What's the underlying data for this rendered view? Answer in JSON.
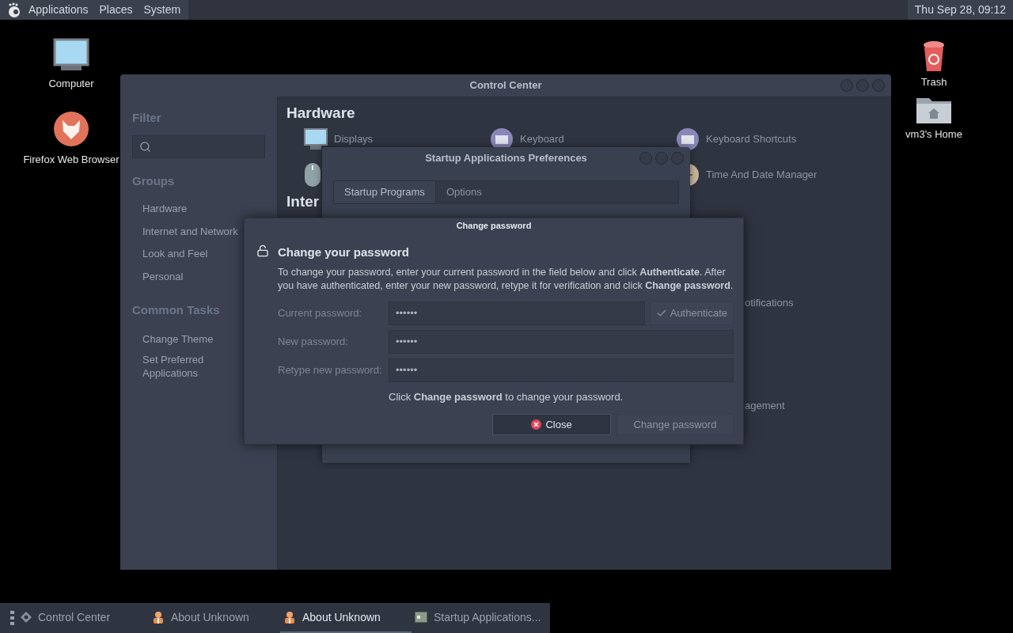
{
  "top_panel": {
    "menus": [
      {
        "label": "Applications"
      },
      {
        "label": "Places"
      },
      {
        "label": "System"
      }
    ],
    "clock": "Thu Sep 28, 09:12"
  },
  "desktop_icons": {
    "left": [
      {
        "label": "Computer",
        "kind": "computer"
      },
      {
        "label": "Firefox Web Browser",
        "kind": "browser"
      }
    ],
    "right": [
      {
        "label": "Trash",
        "kind": "trash"
      },
      {
        "label": "vm3's Home",
        "kind": "home"
      }
    ]
  },
  "control_center": {
    "title": "Control Center",
    "filter_heading": "Filter",
    "groups_heading": "Groups",
    "groups": [
      "Hardware",
      "Internet and Network",
      "Look and Feel",
      "Personal"
    ],
    "common_tasks_heading": "Common Tasks",
    "tasks": [
      "Change Theme",
      "Set Preferred Applications"
    ],
    "sections": [
      {
        "heading": "Hardware",
        "items": [
          {
            "label": "Displays",
            "kind": "display"
          },
          {
            "label": "Keyboard",
            "kind": "keyboard"
          },
          {
            "label": "Keyboard Shortcuts",
            "kind": "shortcuts"
          },
          {
            "kind": "mouse"
          },
          {
            "kind": "covered"
          },
          {
            "label": "Time And Date Manager",
            "kind": "clock"
          }
        ]
      },
      {
        "heading": "Inter"
      }
    ],
    "fragments": [
      "otifications",
      "agement"
    ]
  },
  "startup_window": {
    "title": "Startup Applications Preferences",
    "tabs": [
      {
        "label": "Startup Programs",
        "selected": true
      },
      {
        "label": "Options",
        "selected": false
      }
    ]
  },
  "password_dialog": {
    "title": "Change password",
    "heading": "Change your password",
    "message": "To change your password, enter your current password in the field below and click **Authenticate**. After you have authenticated, enter your new password, retype it for verification and click **Change password**.",
    "fields": [
      {
        "label": "Current password:",
        "value": "••••••",
        "button": {
          "label": "Authenticate",
          "disabled": true
        }
      },
      {
        "label": "New password:",
        "value": "••••••"
      },
      {
        "label": "Retype new password:",
        "value": "••••••"
      }
    ],
    "hint": "Click **Change password** to change your password.",
    "buttons": [
      {
        "label": "Close",
        "kind": "close",
        "disabled": false
      },
      {
        "label": "Change password",
        "kind": "confirm",
        "disabled": true
      }
    ]
  },
  "taskbar": {
    "items": [
      {
        "label": "Control Center",
        "kind": "settings",
        "selected": false
      },
      {
        "label": "About Unknown",
        "kind": "user",
        "selected": false
      },
      {
        "label": "About Unknown",
        "kind": "user",
        "selected": true
      },
      {
        "label": "Startup Applications...",
        "kind": "terminal",
        "selected": false
      }
    ]
  }
}
